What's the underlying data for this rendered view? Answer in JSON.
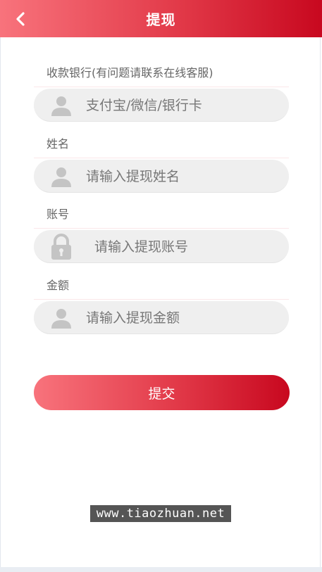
{
  "header": {
    "title": "提现",
    "back_icon": "chevron-left-icon"
  },
  "form": {
    "bank": {
      "label": "收款银行(有问题请联系在线客服)",
      "placeholder": "支付宝/微信/银行卡",
      "icon": "user-icon"
    },
    "name": {
      "label": "姓名",
      "placeholder": "请输入提现姓名",
      "icon": "user-icon"
    },
    "account": {
      "label": "账号",
      "placeholder": "请输入提现账号",
      "icon": "lock-icon"
    },
    "amount": {
      "label": "金额",
      "placeholder": "请输入提现金额",
      "icon": "user-icon"
    },
    "submit_label": "提交"
  },
  "watermark": "www.tiaozhuan.net",
  "colors": {
    "accent_start": "#f8737c",
    "accent_end": "#c8081f",
    "field_bg": "#efefef"
  }
}
